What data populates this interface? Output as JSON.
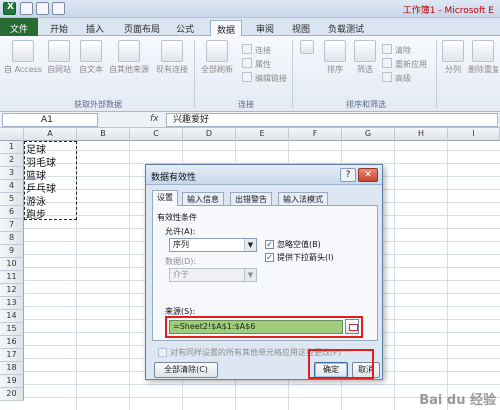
{
  "window": {
    "title": "工作簿1 - Microsoft E"
  },
  "tabs": [
    {
      "label": "文件"
    },
    {
      "label": "开始"
    },
    {
      "label": "插入"
    },
    {
      "label": "页面布局"
    },
    {
      "label": "公式"
    },
    {
      "label": "数据"
    },
    {
      "label": "审阅"
    },
    {
      "label": "视图"
    },
    {
      "label": "负载测试"
    }
  ],
  "ribbon": {
    "get_external": {
      "access": "自 Access",
      "web": "自网站",
      "text": "自文本",
      "other": "自其他来源",
      "existing": "现有连接",
      "group_label": "获取外部数据"
    },
    "connections": {
      "refresh_all": "全部刷新",
      "connections": "连接",
      "properties": "属性",
      "edit_links": "编辑链接",
      "group_label": "连接"
    },
    "sort_filter": {
      "sort": "排序",
      "filter": "筛选",
      "clear": "清除",
      "reapply": "重新应用",
      "advanced": "高级",
      "group_label": "排序和筛选"
    },
    "tools": {
      "split": "分列",
      "remove_dup": "删除重复项"
    }
  },
  "formula_bar": {
    "name_box": "A1",
    "fx": "fx",
    "content": "兴趣爱好"
  },
  "sheet": {
    "columns": [
      "A",
      "B",
      "C",
      "D",
      "E",
      "F",
      "G",
      "H",
      "I"
    ],
    "rows": [
      "1",
      "2",
      "3",
      "4",
      "5",
      "6",
      "7",
      "8",
      "9",
      "10",
      "11",
      "12",
      "13",
      "14",
      "15",
      "16",
      "17",
      "18",
      "19",
      "20"
    ],
    "cells_a": [
      "足球",
      "羽毛球",
      "篮球",
      "乒乓球",
      "游泳",
      "跑步"
    ]
  },
  "dialog": {
    "title": "数据有效性",
    "help": "?",
    "close": "✕",
    "tabs": [
      "设置",
      "输入信息",
      "出错警告",
      "输入法模式"
    ],
    "criteria_label": "有效性条件",
    "allow_label": "允许(A):",
    "allow_value": "序列",
    "ignore_blank": "忽略空值(B)",
    "ignore_blank_checked": true,
    "dropdown": "提供下拉箭头(I)",
    "dropdown_checked": true,
    "data_label": "数据(D):",
    "data_value": "介于",
    "source_label": "来源(S):",
    "source_value": "=Sheet2!$A$1:$A$6",
    "apply_all": "对有同样设置的所有其他单元格应用这些更改(P)",
    "apply_all_checked": false,
    "clear_all": "全部清除(C)",
    "ok": "确定",
    "cancel": "取消"
  },
  "watermark": "Bai du 经验",
  "colors": {
    "highlight": "#e0201c",
    "source_fill": "#9fcc7d",
    "file_tab": "#2a6b34"
  }
}
